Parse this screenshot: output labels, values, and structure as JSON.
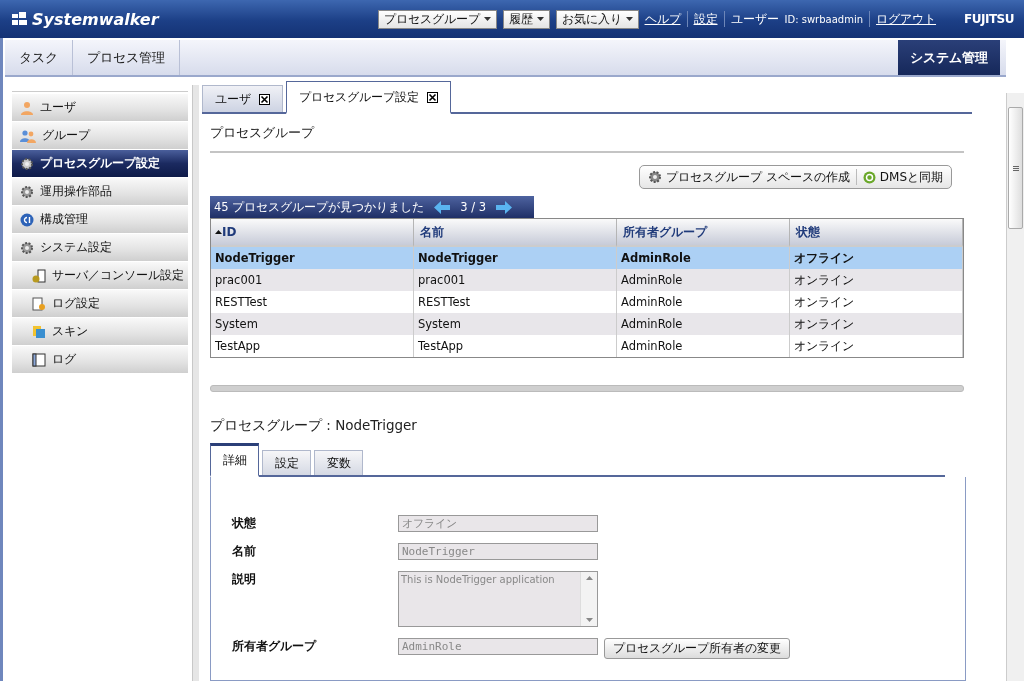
{
  "header": {
    "logo": "Systemwalker",
    "menus": [
      {
        "label": "プロセスグループ"
      },
      {
        "label": "履歴"
      },
      {
        "label": "お気に入り"
      }
    ],
    "links": [
      "ヘルプ",
      "設定"
    ],
    "user_label": "ユーザー",
    "user_id": "ID: swrbaadmin",
    "logout": "ログアウト",
    "brand": "FUJITSU"
  },
  "top_tabs": [
    {
      "label": "タスク",
      "selected": false
    },
    {
      "label": "プロセス管理",
      "selected": false
    },
    {
      "label": "システム管理",
      "selected": true
    }
  ],
  "sidebar": {
    "items": [
      {
        "label": "ユーザ",
        "selected": false
      },
      {
        "label": "グループ",
        "selected": false
      },
      {
        "label": "プロセスグループ設定",
        "selected": true
      },
      {
        "label": "運用操作部品",
        "selected": false
      },
      {
        "label": "構成管理",
        "selected": false
      },
      {
        "label": "システム設定",
        "selected": false,
        "children": [
          {
            "label": "サーバ／コンソール設定",
            "selected": false
          },
          {
            "label": "ログ設定",
            "selected": false
          },
          {
            "label": "スキン",
            "selected": false
          },
          {
            "label": "ログ",
            "selected": false
          }
        ]
      }
    ]
  },
  "content_tabs": [
    {
      "label": "ユーザ",
      "selected": false
    },
    {
      "label": "プロセスグループ設定",
      "selected": true
    }
  ],
  "section_title": "プロセスグループ",
  "actions": [
    "プロセスグループ スペースの作成",
    "DMSと同期"
  ],
  "pager": {
    "summary": "45 プロセスグループが見つかりました",
    "page": "3 / 3"
  },
  "table": {
    "columns": [
      {
        "label": "ID",
        "sorted": true
      },
      {
        "label": "名前",
        "sorted": false
      },
      {
        "label": "所有者グループ",
        "sorted": false
      },
      {
        "label": "状態",
        "sorted": false
      }
    ],
    "rows": [
      {
        "cells": [
          "NodeTrigger",
          "NodeTrigger",
          "AdminRole",
          "オフライン"
        ],
        "selected": true
      },
      {
        "cells": [
          "prac001",
          "prac001",
          "AdminRole",
          "オンライン"
        ],
        "selected": false
      },
      {
        "cells": [
          "RESTTest",
          "RESTTest",
          "AdminRole",
          "オンライン"
        ],
        "selected": false
      },
      {
        "cells": [
          "System",
          "System",
          "AdminRole",
          "オンライン"
        ],
        "selected": false
      },
      {
        "cells": [
          "TestApp",
          "TestApp",
          "AdminRole",
          "オンライン"
        ],
        "selected": false
      }
    ]
  },
  "detail": {
    "title": "プロセスグループ : NodeTrigger",
    "tabs": [
      {
        "label": "詳細",
        "selected": true
      },
      {
        "label": "設定",
        "selected": false
      },
      {
        "label": "変数",
        "selected": false
      }
    ],
    "fields": [
      {
        "label": "状態",
        "kind": "input",
        "value": "オフライン",
        "disabled": true
      },
      {
        "label": "名前",
        "kind": "input",
        "value": "NodeTrigger",
        "disabled": true
      },
      {
        "label": "説明",
        "kind": "textarea",
        "value": "This is NodeTrigger application",
        "disabled": true
      },
      {
        "label": "所有者グループ",
        "kind": "input",
        "value": "AdminRole",
        "disabled": true,
        "button": "プロセスグループ所有者の変更"
      }
    ]
  }
}
